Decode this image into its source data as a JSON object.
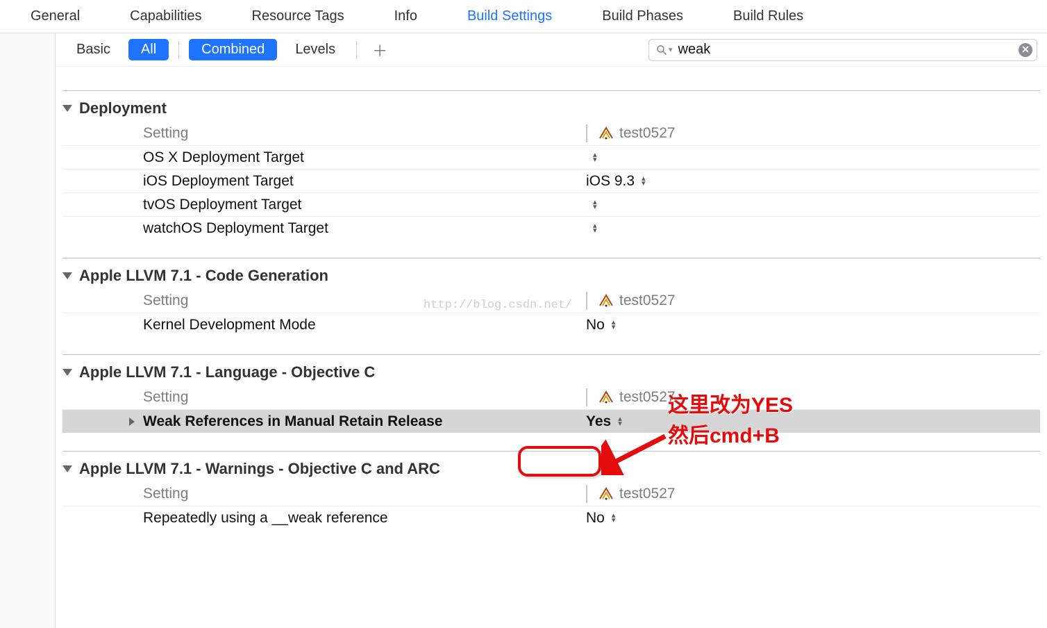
{
  "tabs": {
    "general": "General",
    "capabilities": "Capabilities",
    "resource_tags": "Resource Tags",
    "info": "Info",
    "build_settings": "Build Settings",
    "build_phases": "Build Phases",
    "build_rules": "Build Rules",
    "active": "build_settings"
  },
  "filter_row": {
    "basic": "Basic",
    "all": "All",
    "combined": "Combined",
    "levels": "Levels"
  },
  "search": {
    "value": "weak",
    "placeholder": ""
  },
  "target_name": "test0527",
  "groups": [
    {
      "title": "Deployment",
      "header": "Setting",
      "rows": [
        {
          "name": "OS X Deployment Target",
          "value": "",
          "stepper": true
        },
        {
          "name": "iOS Deployment Target",
          "value": "iOS 9.3",
          "stepper": true
        },
        {
          "name": "tvOS Deployment Target",
          "value": "",
          "stepper": true
        },
        {
          "name": "watchOS Deployment Target",
          "value": "",
          "stepper": true
        }
      ]
    },
    {
      "title": "Apple LLVM 7.1 - Code Generation",
      "header": "Setting",
      "rows": [
        {
          "name": "Kernel Development Mode",
          "value": "No",
          "stepper": true
        }
      ]
    },
    {
      "title": "Apple LLVM 7.1 - Language - Objective C",
      "header": "Setting",
      "rows": [
        {
          "name": "Weak References in Manual Retain Release",
          "value": "Yes",
          "stepper": true,
          "highlight": true,
          "expandable": true
        }
      ]
    },
    {
      "title": "Apple LLVM 7.1 - Warnings - Objective C and ARC",
      "header": "Setting",
      "rows": [
        {
          "name": "Repeatedly using a __weak reference",
          "value": "No",
          "stepper": true
        }
      ]
    }
  ],
  "annotation": {
    "line1": "这里改为YES",
    "line2": "然后cmd+B"
  },
  "watermark": "http://blog.csdn.net/"
}
